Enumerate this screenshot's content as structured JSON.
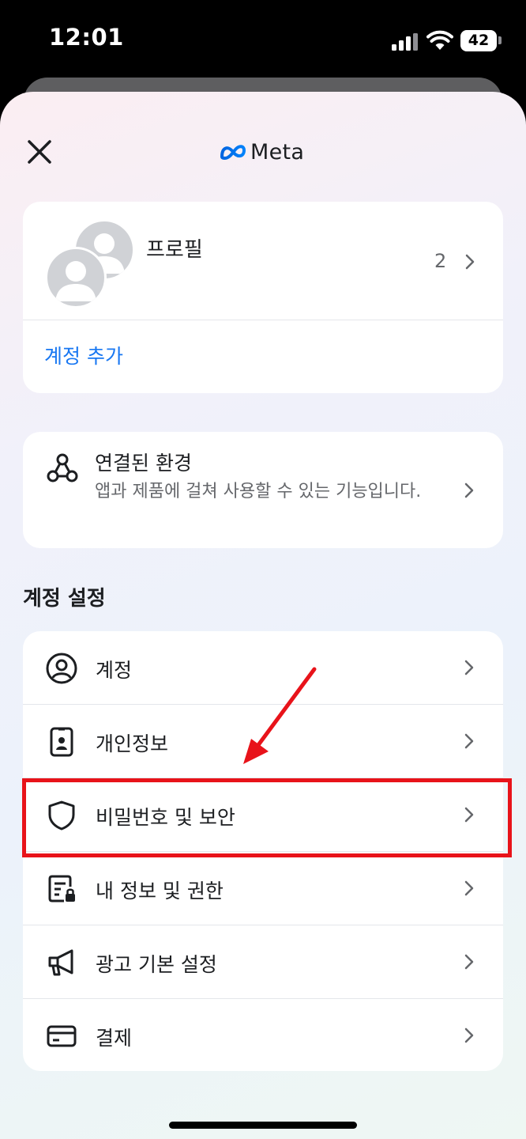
{
  "status_bar": {
    "time": "12:01",
    "battery": "42"
  },
  "header": {
    "logo_text": "Meta"
  },
  "profile": {
    "label": "프로필",
    "count": "2",
    "add_account": "계정 추가"
  },
  "connected": {
    "title": "연결된 환경",
    "description": "앱과 제품에 걸쳐 사용할 수 있는 기능입니다."
  },
  "account_settings": {
    "title": "계정 설정",
    "items": [
      {
        "label": "계정",
        "icon": "person-circle-icon"
      },
      {
        "label": "개인정보",
        "icon": "id-card-icon"
      },
      {
        "label": "비밀번호 및 보안",
        "icon": "shield-icon"
      },
      {
        "label": "내 정보 및 권한",
        "icon": "document-lock-icon"
      },
      {
        "label": "광고 기본 설정",
        "icon": "megaphone-icon"
      },
      {
        "label": "결제",
        "icon": "credit-card-icon"
      }
    ]
  },
  "colors": {
    "accent": "#1877f2",
    "highlight": "#e8131a"
  }
}
